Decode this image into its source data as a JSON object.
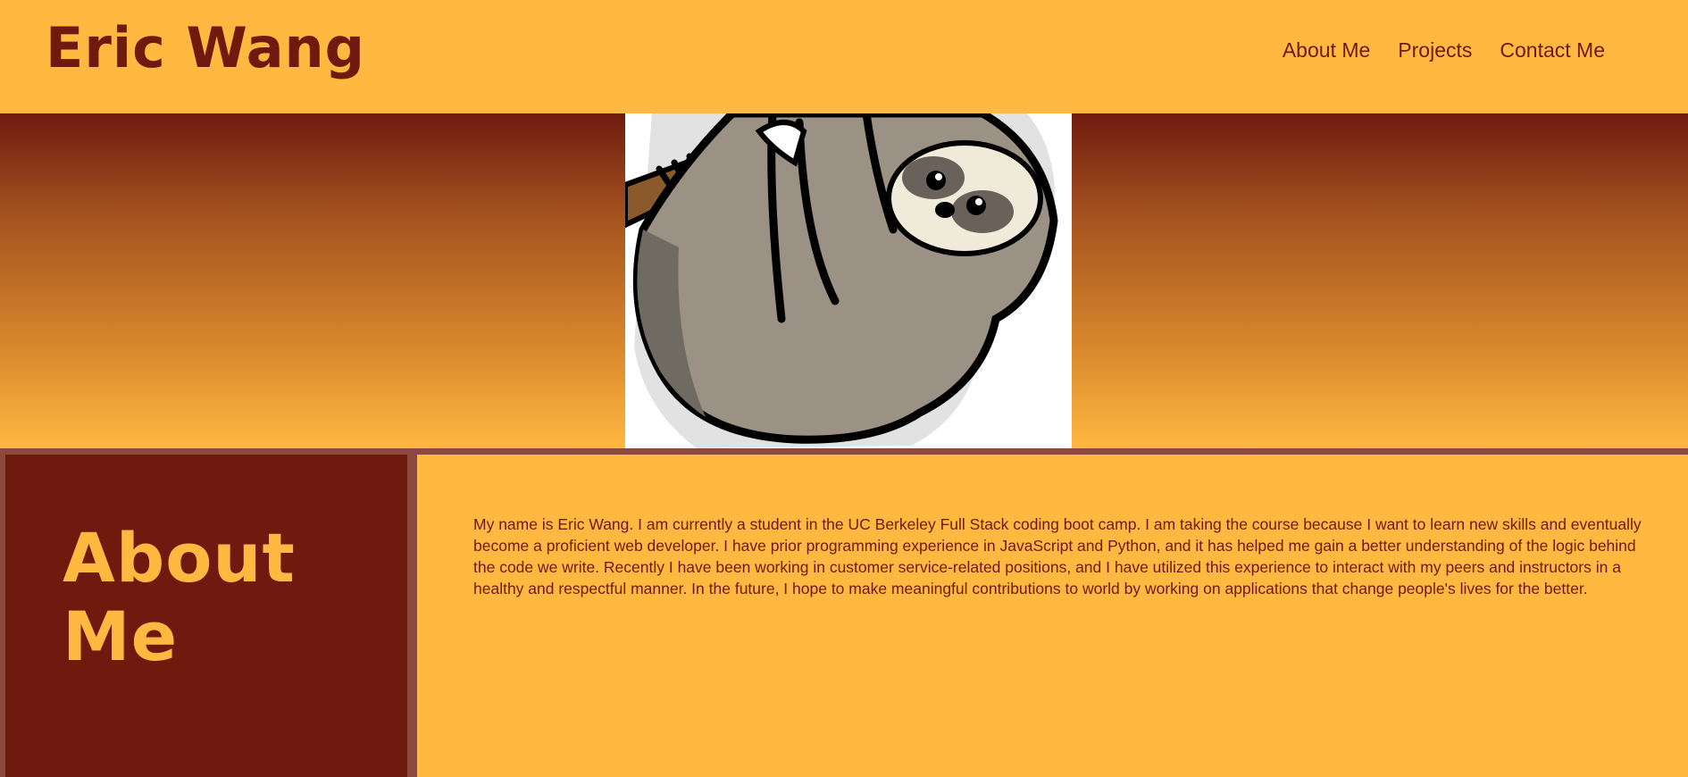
{
  "header": {
    "title": "Eric Wang",
    "nav": [
      {
        "label": "About Me"
      },
      {
        "label": "Projects"
      },
      {
        "label": "Contact Me"
      }
    ]
  },
  "hero": {
    "image": "sloth-illustration"
  },
  "about": {
    "heading": "About Me",
    "body": "My name is Eric Wang. I am currently a student in the UC Berkeley Full Stack coding boot camp. I am taking the course because I want to learn new skills and eventually become a proficient web developer. I have prior programming experience in JavaScript and Python, and it has helped me gain a better understanding of the logic behind the code we write. Recently I have been working in customer service-related positions, and I have utilized this experience to interact with my peers and instructors in a healthy and respectful manner. In the future, I hope to make meaningful contributions to world by working on applications that change people's lives for the better."
  },
  "colors": {
    "primary": "#ffb840",
    "dark": "#6f1a0f",
    "divider": "#8b4a3c"
  }
}
